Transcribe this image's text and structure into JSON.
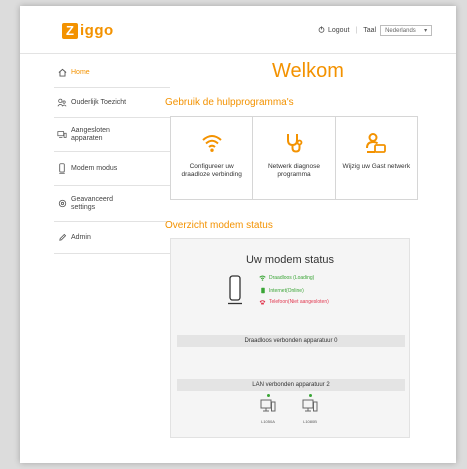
{
  "header": {
    "logo_mark": "Z",
    "logo_text": "iggo",
    "logout": "Logout",
    "taal_label": "Taal",
    "language": "Nederlands"
  },
  "sidebar": {
    "items": [
      {
        "label": "Home",
        "icon": "home-icon"
      },
      {
        "label": "Ouderlijk Toezicht",
        "icon": "parental-control-icon"
      },
      {
        "label": "Aangesloten apparaten",
        "icon": "devices-icon"
      },
      {
        "label": "Modem modus",
        "icon": "modem-icon"
      },
      {
        "label": "Geavanceerd settings",
        "icon": "settings-icon"
      },
      {
        "label": "Admin",
        "icon": "pencil-icon"
      }
    ]
  },
  "main": {
    "title": "Welkom",
    "tools_section": "Gebruik de hulpprogramma's",
    "tools": [
      {
        "label": "Configureer uw draadloze verbinding",
        "icon": "wifi-icon"
      },
      {
        "label": "Netwerk diagnose programma",
        "icon": "stethoscope-icon"
      },
      {
        "label": "Wijzig uw Gast netwerk",
        "icon": "guest-network-icon"
      }
    ],
    "status_section": "Overzicht modem status"
  },
  "modem": {
    "title": "Uw modem status",
    "statuses": [
      {
        "label": "Draadloos (Loading)",
        "color": "#3aa536"
      },
      {
        "label": "Internet(Online)",
        "color": "#3aa536"
      },
      {
        "label": "Telefoon(Niet aangesloten)",
        "color": "#e2374f"
      }
    ],
    "wireless_bar": "Draadloos verbonden apparatuur 0",
    "lan_bar": "LAN verbonden apparatuur 2",
    "devices": [
      "L1050A",
      "L1080B"
    ]
  },
  "colors": {
    "accent": "#f39200",
    "ok": "#3aa536",
    "error": "#e2374f"
  }
}
